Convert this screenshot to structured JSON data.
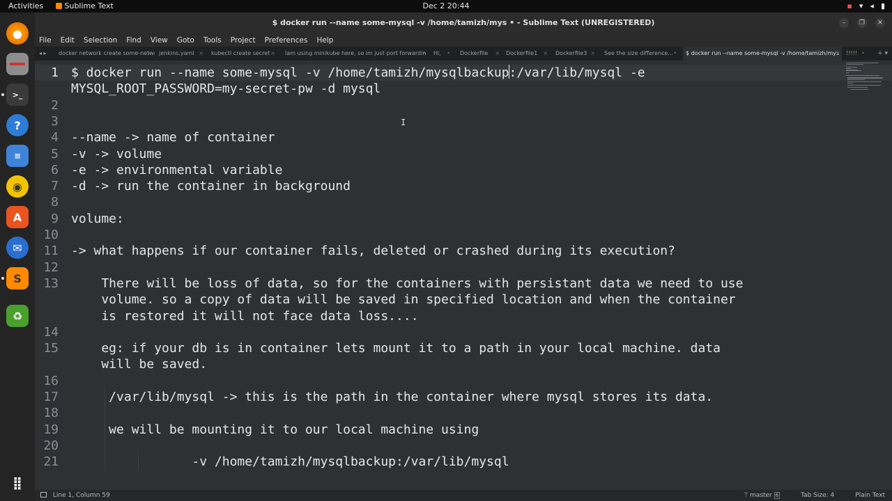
{
  "topbar": {
    "activities": "Activities",
    "app_name": "Sublime Text",
    "clock": "Dec 2  20:44"
  },
  "dock": {
    "items": [
      {
        "name": "firefox-icon",
        "color": "#e66000"
      },
      {
        "name": "files-icon",
        "color": "#8d8d8d"
      },
      {
        "name": "terminal-icon",
        "color": "#3a3a3a"
      },
      {
        "name": "help-icon",
        "color": "#2e7cd6"
      },
      {
        "name": "document-viewer-icon",
        "color": "#3d83d8"
      },
      {
        "name": "rhythmbox-icon",
        "color": "#f2c400"
      },
      {
        "name": "app-center-icon",
        "color": "#e95420"
      },
      {
        "name": "thunderbird-icon",
        "color": "#2a6ed1"
      },
      {
        "name": "sublime-text-icon",
        "color": "#ff8a00"
      },
      {
        "name": "trash-icon",
        "color": "#4aa02c"
      },
      {
        "name": "show-apps-icon",
        "color": "#242424"
      }
    ]
  },
  "window": {
    "title": "$ docker run --name some-mysql -v /home/tamizh/mys • - Sublime Text (UNREGISTERED)"
  },
  "menu": [
    "File",
    "Edit",
    "Selection",
    "Find",
    "View",
    "Goto",
    "Tools",
    "Project",
    "Preferences",
    "Help"
  ],
  "tabs": [
    {
      "label": "docker network create some-network",
      "close": "×"
    },
    {
      "label": "jenkins.yaml",
      "close": "×"
    },
    {
      "label": "kubectl create secret",
      "close": "×"
    },
    {
      "label": "Iam using minikube here, so im just port forwardin",
      "close": "•"
    },
    {
      "label": "Hi,",
      "close": "•"
    },
    {
      "label": "Dockerfile",
      "close": "×"
    },
    {
      "label": "Dockerfile1",
      "close": "×"
    },
    {
      "label": "Dockerfile3",
      "close": "×"
    },
    {
      "label": "See the size difference...",
      "close": "•"
    },
    {
      "label": "$ docker run --name some-mysql -v /home/tamizh/mys",
      "close": "•"
    },
    {
      "label": "!!!!!",
      "close": "•"
    }
  ],
  "editor": {
    "lines": [
      {
        "num": "1",
        "text": "$ docker run --name some-mysql -v /home/tamizh/mysqlbackup:/var/lib/mysql -e"
      },
      {
        "num": "",
        "text": "MYSQL_ROOT_PASSWORD=my-secret-pw -d mysql"
      },
      {
        "num": "2",
        "text": ""
      },
      {
        "num": "3",
        "text": ""
      },
      {
        "num": "4",
        "text": "--name -> name of container"
      },
      {
        "num": "5",
        "text": "-v -> volume"
      },
      {
        "num": "6",
        "text": "-e -> environmental variable"
      },
      {
        "num": "7",
        "text": "-d -> run the container in background"
      },
      {
        "num": "8",
        "text": ""
      },
      {
        "num": "9",
        "text": "volume:"
      },
      {
        "num": "10",
        "text": ""
      },
      {
        "num": "11",
        "text": "-> what happens if our container fails, deleted or crashed during its execution?"
      },
      {
        "num": "12",
        "text": ""
      },
      {
        "num": "13",
        "text": "    There will be loss of data, so for the containers with persistant data we need to use"
      },
      {
        "num": "",
        "text": "    volume. so a copy of data will be saved in specified location and when the container"
      },
      {
        "num": "",
        "text": "    is restored it will not face data loss...."
      },
      {
        "num": "14",
        "text": ""
      },
      {
        "num": "15",
        "text": "    eg: if your db is in container lets mount it to a path in your local machine. data"
      },
      {
        "num": "",
        "text": "    will be saved."
      },
      {
        "num": "16",
        "text": ""
      },
      {
        "num": "17",
        "text": "     /var/lib/mysql -> this is the path in the container where mysql stores its data."
      },
      {
        "num": "18",
        "text": ""
      },
      {
        "num": "19",
        "text": "     we will be mounting it to our local machine using"
      },
      {
        "num": "20",
        "text": ""
      },
      {
        "num": "21",
        "text": "                -v /home/tamizh/mysqlbackup:/var/lib/mysql"
      }
    ],
    "first_line_before_caret": "$ docker run --name some-mysql -v /home/tamizh/mysqlbackup",
    "first_line_after_caret": ":/var/lib/mysql -e"
  },
  "status": {
    "position": "Line 1, Column 59",
    "branch": "master",
    "branch_count": "6",
    "tab_size": "Tab Size: 4",
    "syntax": "Plain Text"
  }
}
